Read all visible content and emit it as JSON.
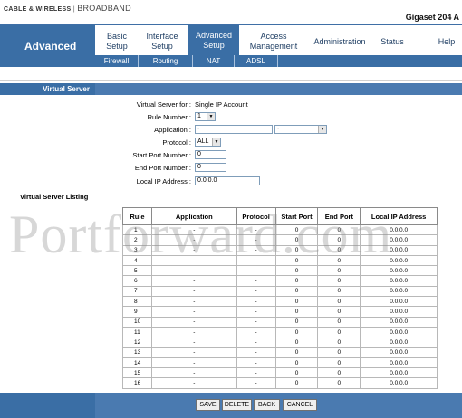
{
  "brand": {
    "logo_text": "CABLE & WIRELESS",
    "logo_sub": "BROADBAND",
    "model": "Gigaset 204 A"
  },
  "section": "Advanced",
  "nav": {
    "items": [
      {
        "line1": "Basic",
        "line2": "Setup"
      },
      {
        "line1": "Interface",
        "line2": "Setup"
      },
      {
        "line1": "Advanced",
        "line2": "Setup"
      },
      {
        "line1": "Access",
        "line2": "Management"
      },
      {
        "line1": "Administration",
        "line2": ""
      },
      {
        "line1": "Status",
        "line2": ""
      },
      {
        "line1": "Help",
        "line2": ""
      }
    ],
    "subitems": [
      "Firewall",
      "Routing",
      "NAT",
      "ADSL"
    ]
  },
  "virtual_server": {
    "header": "Virtual Server",
    "for_label": "Virtual Server for :",
    "for_value": "Single IP Account",
    "rule_number_label": "Rule Number :",
    "rule_number_value": "1",
    "application_label": "Application :",
    "application_value": "-",
    "application_select": "-",
    "protocol_label": "Protocol :",
    "protocol_value": "ALL",
    "start_port_label": "Start Port Number :",
    "start_port_value": "0",
    "end_port_label": "End Port Number :",
    "end_port_value": "0",
    "local_ip_label": "Local IP Address :",
    "local_ip_value": "0.0.0.0"
  },
  "listing": {
    "title": "Virtual Server Listing",
    "columns": [
      "Rule",
      "Application",
      "Protocol",
      "Start Port",
      "End Port",
      "Local IP Address"
    ],
    "rows": [
      [
        "1",
        "-",
        "-",
        "0",
        "0",
        "0.0.0.0"
      ],
      [
        "2",
        "-",
        "-",
        "0",
        "0",
        "0.0.0.0"
      ],
      [
        "3",
        "-",
        "-",
        "0",
        "0",
        "0.0.0.0"
      ],
      [
        "4",
        "-",
        "-",
        "0",
        "0",
        "0.0.0.0"
      ],
      [
        "5",
        "-",
        "-",
        "0",
        "0",
        "0.0.0.0"
      ],
      [
        "6",
        "-",
        "-",
        "0",
        "0",
        "0.0.0.0"
      ],
      [
        "7",
        "-",
        "-",
        "0",
        "0",
        "0.0.0.0"
      ],
      [
        "8",
        "-",
        "-",
        "0",
        "0",
        "0.0.0.0"
      ],
      [
        "9",
        "-",
        "-",
        "0",
        "0",
        "0.0.0.0"
      ],
      [
        "10",
        "-",
        "-",
        "0",
        "0",
        "0.0.0.0"
      ],
      [
        "11",
        "-",
        "-",
        "0",
        "0",
        "0.0.0.0"
      ],
      [
        "12",
        "-",
        "-",
        "0",
        "0",
        "0.0.0.0"
      ],
      [
        "13",
        "-",
        "-",
        "0",
        "0",
        "0.0.0.0"
      ],
      [
        "14",
        "-",
        "-",
        "0",
        "0",
        "0.0.0.0"
      ],
      [
        "15",
        "-",
        "-",
        "0",
        "0",
        "0.0.0.0"
      ],
      [
        "16",
        "-",
        "-",
        "0",
        "0",
        "0.0.0.0"
      ]
    ]
  },
  "buttons": {
    "save": "SAVE",
    "delete": "DELETE",
    "back": "BACK",
    "cancel": "CANCEL"
  },
  "watermark": "Portforward.com",
  "colors": {
    "nav_blue": "#3a6ea5",
    "bar_blue": "#4a7ab0",
    "nav_text": "#1f3e63"
  }
}
